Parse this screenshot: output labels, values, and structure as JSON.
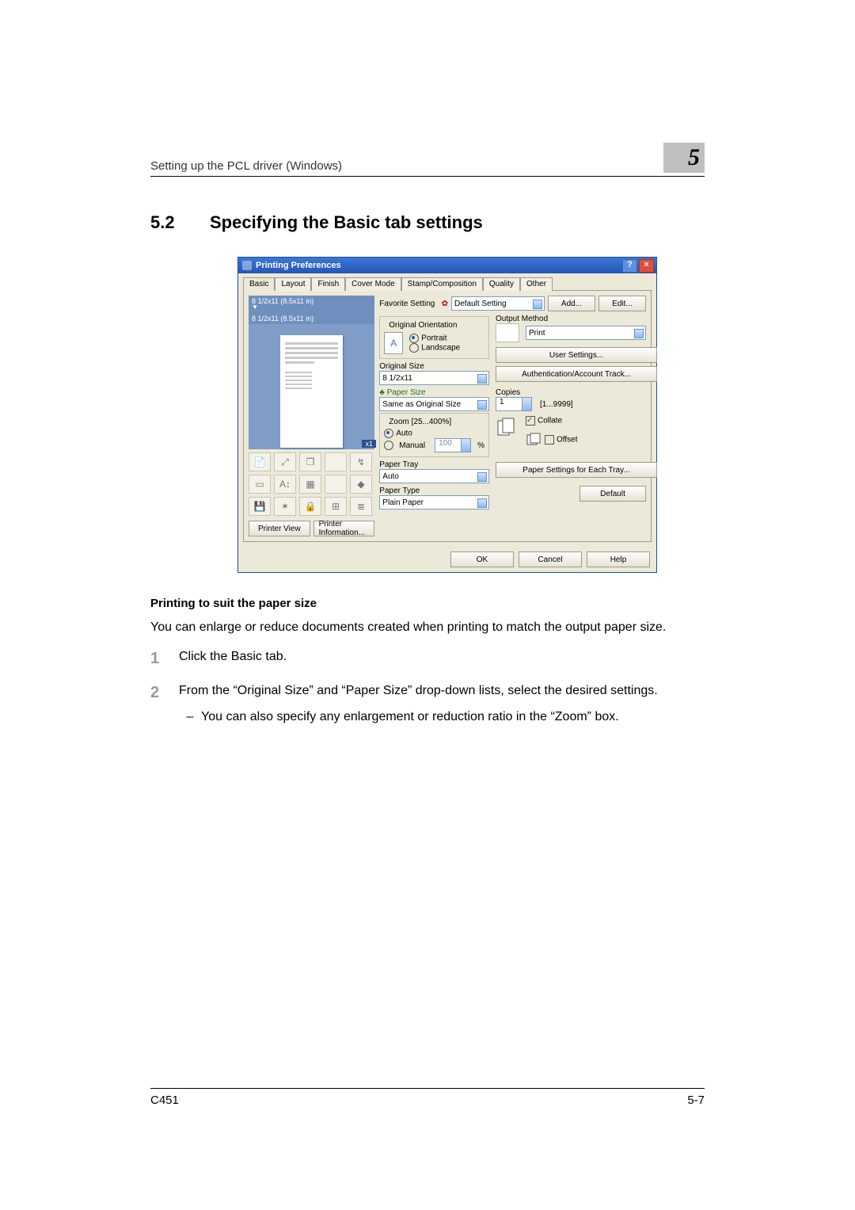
{
  "running_head": "Setting up the PCL driver (Windows)",
  "chapter_number": "5",
  "section": {
    "number": "5.2",
    "title": "Specifying the Basic tab settings"
  },
  "dialog": {
    "title": "Printing Preferences",
    "help_btn": "?",
    "close_btn": "×",
    "tabs": [
      "Basic",
      "Layout",
      "Finish",
      "Cover Mode",
      "Stamp/Composition",
      "Quality",
      "Other"
    ],
    "active_tab": 0,
    "favorite": {
      "label": "Favorite Setting",
      "value": "Default Setting",
      "add_btn": "Add...",
      "edit_btn": "Edit..."
    },
    "preview": {
      "line_top": "8 1/2x11 (8.5x11 in)",
      "line_bottom": "8 1/2x11 (8.5x11 in)",
      "multiplier_badge": "x1",
      "printer_view_btn": "Printer View",
      "printer_info_btn": "Printer Information..."
    },
    "orientation": {
      "legend": "Original Orientation",
      "portrait": "Portrait",
      "landscape": "Landscape",
      "selected": "portrait"
    },
    "original_size": {
      "label": "Original Size",
      "value": "8 1/2x11"
    },
    "paper_size": {
      "label": "Paper Size",
      "value": "Same as Original Size"
    },
    "zoom": {
      "legend": "Zoom [25...400%]",
      "auto": "Auto",
      "manual": "Manual",
      "manual_value": "100",
      "unit": "%",
      "selected": "auto"
    },
    "paper_tray": {
      "label": "Paper Tray",
      "value": "Auto"
    },
    "paper_type": {
      "label": "Paper Type",
      "value": "Plain Paper"
    },
    "output_method": {
      "label": "Output Method",
      "value": "Print"
    },
    "user_settings_btn": "User Settings...",
    "auth_btn": "Authentication/Account Track...",
    "copies": {
      "label": "Copies",
      "value": "1",
      "range": "[1...9999]"
    },
    "collate": {
      "label": "Collate",
      "checked": true
    },
    "offset": {
      "label": "Offset",
      "checked": false
    },
    "paper_each_tray_btn": "Paper Settings for Each Tray...",
    "default_btn": "Default",
    "footer": {
      "ok": "OK",
      "cancel": "Cancel",
      "help": "Help"
    }
  },
  "subhead": "Printing to suit the paper size",
  "intro": "You can enlarge or reduce documents created when printing to match the output paper size.",
  "steps": {
    "s1": {
      "num": "1",
      "text": "Click the Basic tab."
    },
    "s2": {
      "num": "2",
      "text": "From the “Original Size” and “Paper Size” drop-down lists, select the desired settings.",
      "sub": "You can also specify any enlargement or reduction ratio in the “Zoom” box."
    }
  },
  "footer": {
    "left": "C451",
    "right": "5-7"
  }
}
